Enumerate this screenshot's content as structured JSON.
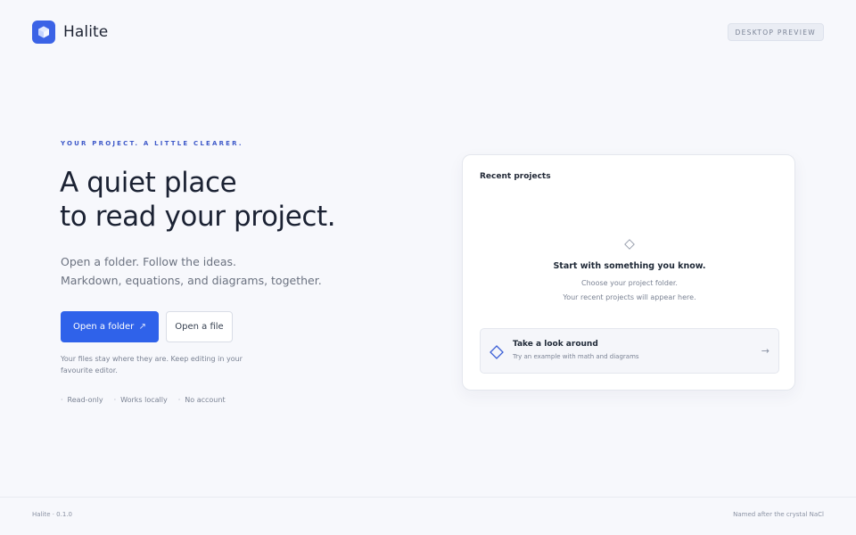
{
  "app": {
    "name": "Halite",
    "badge": "DESKTOP PREVIEW"
  },
  "hero": {
    "eyebrow": "YOUR PROJECT. A LITTLE CLEARER.",
    "headline_line1": "A quiet place",
    "headline_line2": "to read your project.",
    "sub_line1": "Open a folder. Follow the ideas.",
    "sub_line2": "Markdown, equations, and diagrams, together.",
    "primary_button": "Open a folder",
    "primary_button_icon": "↗",
    "secondary_button": "Open a file",
    "note": "Your files stay where they are. Keep editing in your favourite editor.",
    "features": [
      "Read-only",
      "Works locally",
      "No account"
    ]
  },
  "recent": {
    "title": "Recent projects",
    "empty_title": "Start with something you know.",
    "empty_line1": "Choose your project folder.",
    "empty_line2": "Your recent projects will appear here.",
    "empty_icon": "diamond-outline-icon",
    "tour_title": "Take a look around",
    "tour_subtitle": "Try an example with math and diagrams",
    "tour_icon": "diamond-icon",
    "tour_arrow": "→"
  },
  "footer": {
    "version": "Halite · 0.1.0",
    "tagline": "Named after the crystal NaCl"
  },
  "colors": {
    "accent": "#2f62ea",
    "background": "#f7f8fc",
    "eyebrow": "#3f5ac9"
  }
}
